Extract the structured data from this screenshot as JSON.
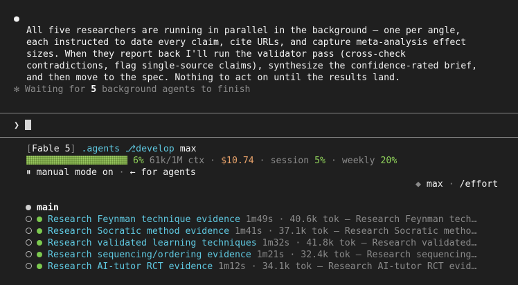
{
  "message": {
    "bullet": "●",
    "lines": [
      "All five researchers are running in parallel in the background — one per angle,",
      "each instructed to date every claim, cite URLs, and capture meta-analysis effect",
      "sizes. When they report back I'll run the validator pass (cross-check",
      "contradictions, flag single-source claims), synthesize the confidence-rated brief,",
      "and then move to the spec. Nothing to act on until the results land."
    ]
  },
  "waiting": {
    "star": "✻",
    "prefix": "Waiting for ",
    "count": "5",
    "suffix": " background agents to finish"
  },
  "prompt": {
    "symbol": "❯"
  },
  "status": {
    "bracket_open": "[",
    "model": "Fable 5",
    "bracket_close": "]",
    "dir": ".agents",
    "branch_icon": "⎇",
    "branch": "develop",
    "effort": "max",
    "ctx_percent": "6%",
    "ctx_percent_value": 6,
    "ctx": "61k/1M ctx",
    "sep": "·",
    "cost": "$10.74",
    "session_label": "session",
    "session_percent": "5%",
    "weekly_label": "weekly",
    "weekly_percent": "20%",
    "mode_icon": "⏸",
    "mode": "manual mode on",
    "agents_hint": "← for agents",
    "effort_icon": "◆",
    "effort_right": "max",
    "effort_cmd": "/effort"
  },
  "agents": {
    "main_label": "main",
    "items": [
      {
        "name": "Research Feynman technique evidence",
        "time": "1m49s",
        "tok": "40.6k tok",
        "desc": "— Research Feynman tech…"
      },
      {
        "name": "Research Socratic method evidence",
        "time": "1m41s",
        "tok": "37.1k tok",
        "desc": "— Research Socratic metho…"
      },
      {
        "name": "Research validated learning techniques",
        "time": "1m32s",
        "tok": "41.8k tok",
        "desc": "— Research validated…"
      },
      {
        "name": "Research sequencing/ordering evidence",
        "time": "1m21s",
        "tok": "32.4k tok",
        "desc": "— Research sequencing…"
      },
      {
        "name": "Research AI-tutor RCT evidence",
        "time": "1m12s",
        "tok": "34.1k tok",
        "desc": "— Research AI-tutor RCT evid…"
      }
    ]
  },
  "colors": {
    "background": "#1f1f1f",
    "accent_cyan": "#5fc8e0",
    "accent_green": "#8fd15a",
    "cost_orange": "#e8a26a"
  }
}
